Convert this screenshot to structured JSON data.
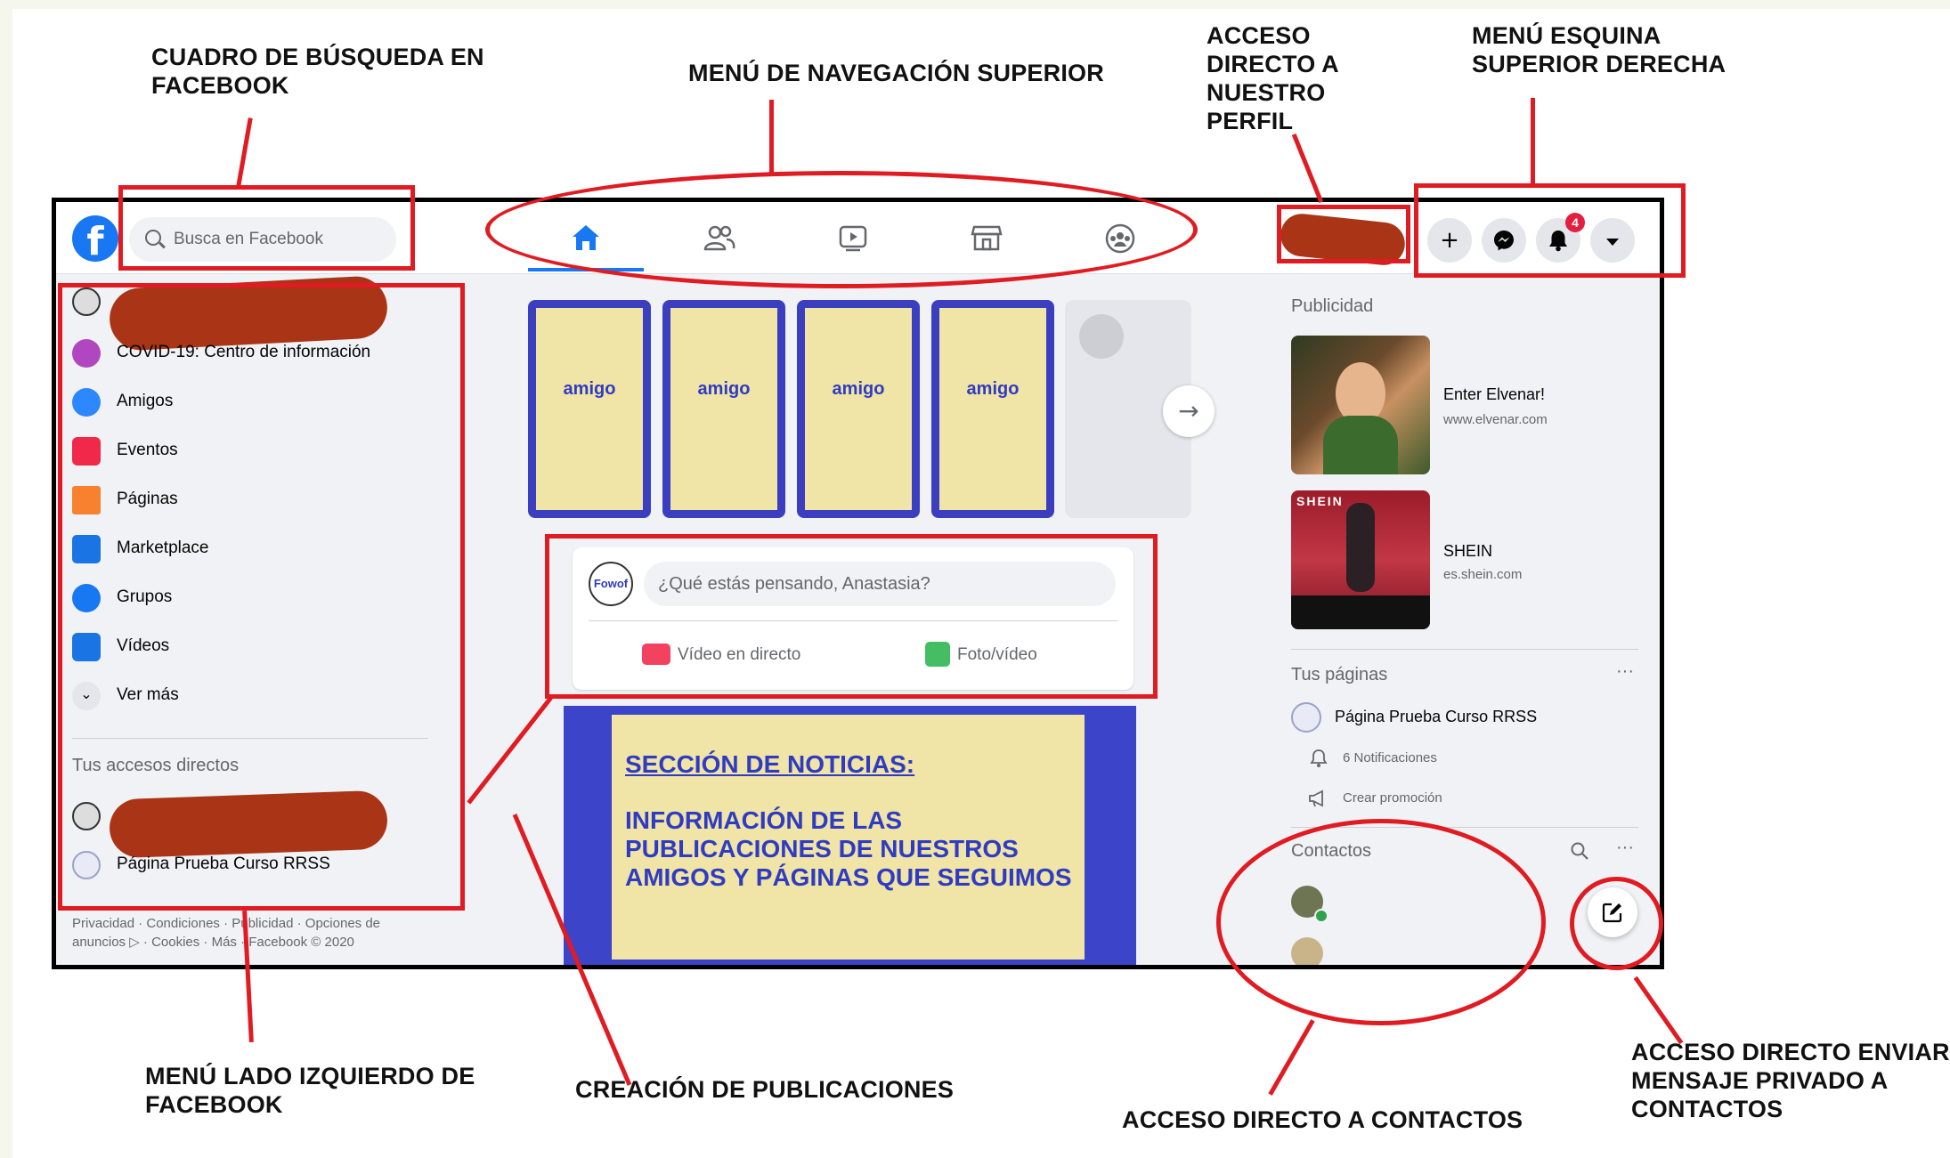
{
  "callouts": {
    "search_box": [
      "CUADRO DE BÚSQUEDA EN",
      "FACEBOOK"
    ],
    "top_nav": "MENÚ DE NAVEGACIÓN SUPERIOR",
    "profile_shortcut": [
      "ACCESO",
      "DIRECTO A",
      "NUESTRO",
      "PERFIL"
    ],
    "top_right_menu": [
      "MENÚ ESQUINA",
      "SUPERIOR DERECHA"
    ],
    "left_menu": [
      "MENÚ LADO IZQUIERDO DE",
      "FACEBOOK"
    ],
    "post_creation": "CREACIÓN DE PUBLICACIONES",
    "contacts_shortcut": "ACCESO DIRECTO A CONTACTOS",
    "private_message": [
      "ACCESO DIRECTO ENVIAR",
      "MENSAJE PRIVADO A",
      "CONTACTOS"
    ]
  },
  "topbar": {
    "logo_icon": "facebook-logo",
    "search_placeholder": "Busca en Facebook",
    "nav_tabs": [
      "home-icon",
      "friends-icon",
      "watch-icon",
      "marketplace-icon",
      "groups-icon"
    ],
    "notifications_count": "4",
    "accent": "#1877f2"
  },
  "left_menu": {
    "items": [
      {
        "label": "COVID-19: Centro de información",
        "icon": "covid-shield-icon"
      },
      {
        "label": "Amigos",
        "icon": "friends-icon"
      },
      {
        "label": "Eventos",
        "icon": "events-icon"
      },
      {
        "label": "Páginas",
        "icon": "flag-icon"
      },
      {
        "label": "Marketplace",
        "icon": "store-icon"
      },
      {
        "label": "Grupos",
        "icon": "groups-icon"
      },
      {
        "label": "Vídeos",
        "icon": "video-icon"
      },
      {
        "label": "Ver más",
        "icon": "chevron-down-icon"
      }
    ],
    "shortcuts_heading": "Tus accesos directos",
    "shortcut_page": "Página Prueba Curso RRSS",
    "footer_line1": "Privacidad · Condiciones · Publicidad · Opciones de",
    "footer_line2": "anuncios ▷ · Cookies · Más · Facebook © 2020"
  },
  "stories": {
    "labels": [
      "amigo",
      "amigo",
      "amigo",
      "amigo"
    ]
  },
  "composer": {
    "avatar_text": "Fowof",
    "placeholder": "¿Qué estás pensando, Anastasia?",
    "live_video": "Vídeo en directo",
    "photo_video": "Foto/vídeo"
  },
  "news": {
    "title": "SECCIÓN DE NOTICIAS:",
    "line1": "INFORMACIÓN DE LAS",
    "line2": "PUBLICACIONES DE NUESTROS",
    "line3": "AMIGOS Y PÁGINAS QUE SEGUIMOS"
  },
  "right_column": {
    "ads_heading": "Publicidad",
    "ads": [
      {
        "title": "Enter Elvenar!",
        "url": "www.elvenar.com"
      },
      {
        "title": "SHEIN",
        "url": "es.shein.com"
      }
    ],
    "shein_banner": "SHEIN",
    "pages_heading": "Tus páginas",
    "page_name": "Página Prueba Curso RRSS",
    "notifications": "6 Notificaciones",
    "create_promo": "Crear promoción",
    "contacts_heading": "Contactos"
  }
}
